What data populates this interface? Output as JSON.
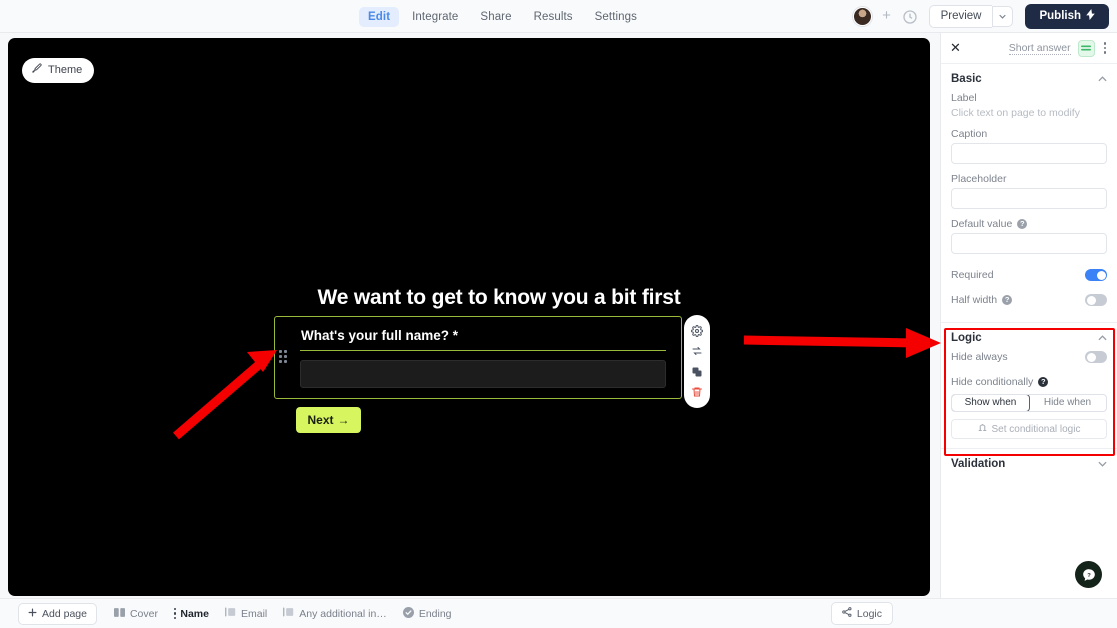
{
  "topbar": {
    "nav": [
      {
        "label": "Edit",
        "active": true
      },
      {
        "label": "Integrate",
        "active": false
      },
      {
        "label": "Share",
        "active": false
      },
      {
        "label": "Results",
        "active": false
      },
      {
        "label": "Settings",
        "active": false
      }
    ],
    "add_label": "+",
    "preview_label": "Preview",
    "preview_caret": "⌄",
    "publish_label": "Publish",
    "publish_icon": "⚡",
    "publish_color": "#1f2b45",
    "active_tab_color": "#4a89e8"
  },
  "canvas": {
    "theme_label": "Theme",
    "theme_icon": "paintbrush-icon",
    "background_color": "#000000",
    "form": {
      "title": "We want to get to know you a bit first",
      "field_label": "What's your full name? *",
      "field_required_marker": "*",
      "input_value": "",
      "next_label": "Next",
      "next_arrow": "→",
      "next_color": "#d6f55e",
      "selection_outline_color": "#9aba3c"
    },
    "block_tools": [
      {
        "name": "settings-gear-icon",
        "label": "Settings"
      },
      {
        "name": "move-swap-icon",
        "label": "Move"
      },
      {
        "name": "duplicate-icon",
        "label": "Duplicate"
      },
      {
        "name": "delete-trash-icon",
        "label": "Delete"
      }
    ]
  },
  "bottombar": {
    "add_page_label": "Add page",
    "tabs": [
      {
        "label": "Cover",
        "icon": "book-icon",
        "active": false
      },
      {
        "label": "Name",
        "icon": "drag-handle-icon",
        "active": true
      },
      {
        "label": "Email",
        "icon": "form-page-icon",
        "active": false
      },
      {
        "label": "Any additional in…",
        "icon": "form-page-icon",
        "active": false
      },
      {
        "label": "Ending",
        "icon": "check-circle-icon",
        "active": false
      }
    ],
    "logic_label": "Logic"
  },
  "right_panel": {
    "close_icon": "✕",
    "question_type": "Short answer",
    "type_badge_icon": "equal-lines-icon",
    "kebab_icon": "more-vertical-icon",
    "basic": {
      "title": "Basic",
      "collapse_icon": "⌃",
      "label_title": "Label",
      "label_hint": "Click text on page to modify",
      "caption_title": "Caption",
      "caption_value": "",
      "placeholder_title": "Placeholder",
      "placeholder_value": "",
      "default_title": "Default value",
      "default_value": "",
      "default_help_icon": "help-icon",
      "required_label": "Required",
      "required_on": true,
      "half_width_label": "Half width",
      "half_width_help_icon": "help-icon",
      "half_width_on": false
    },
    "logic": {
      "title": "Logic",
      "collapse_icon": "⌃",
      "hide_always_label": "Hide always",
      "hide_always_on": false,
      "hide_conditionally_label": "Hide conditionally",
      "hide_conditionally_help_icon": "help-icon",
      "segment_show": "Show when",
      "segment_hide": "Hide when",
      "segment_selected": "Show when",
      "set_logic_label": "Set conditional logic",
      "set_logic_icon": "branch-icon"
    },
    "validation": {
      "title": "Validation",
      "expand_icon": "⌄"
    }
  },
  "help": {
    "icon": "help-chat-icon",
    "color": "#15241a"
  },
  "annotations": {
    "highlight_color": "#f50000",
    "arrow_to_field": "points at form field block",
    "arrow_to_logic": "points at Logic section",
    "box_around_logic": "Logic section highlighted"
  }
}
